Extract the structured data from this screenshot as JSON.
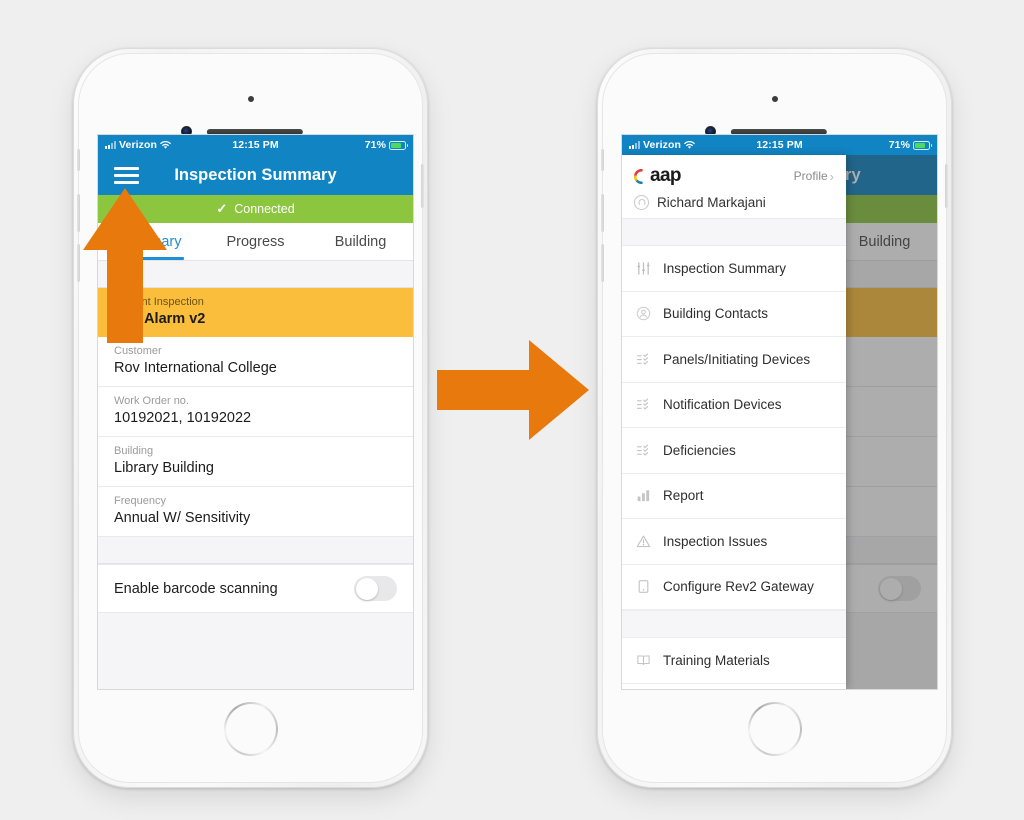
{
  "colors": {
    "page_background": "#efefef",
    "brand_blue": "#1184c4",
    "accent_green": "#8cc63f",
    "highlight_yellow": "#fbbd3c",
    "arrow_orange": "#e8790c",
    "tab_active_blue": "#1e8fd5"
  },
  "status_bar": {
    "carrier": "Verizon",
    "wifi_icon": "wifi-icon",
    "signal_icon": "signal-bars-icon",
    "time": "12:15 PM",
    "battery_percent": "71%",
    "battery_icon": "battery-charging-icon"
  },
  "left_phone": {
    "nav": {
      "menu_icon": "hamburger-menu-icon",
      "title": "Inspection Summary"
    },
    "connection_banner": {
      "check_icon": "✓",
      "label": "Connected"
    },
    "tabs": [
      {
        "label": "Summary",
        "active": true
      },
      {
        "label": "Progress",
        "active": false
      },
      {
        "label": "Building",
        "active": false
      }
    ],
    "fields": [
      {
        "label": "Current Inspection",
        "value": "Fire Alarm v2",
        "highlighted": true
      },
      {
        "label": "Customer",
        "value": "Rov International College",
        "highlighted": false
      },
      {
        "label": "Work Order no.",
        "value": "10192021, 10192022",
        "highlighted": false
      },
      {
        "label": "Building",
        "value": "Library Building",
        "highlighted": false
      },
      {
        "label": "Frequency",
        "value": "Annual W/ Sensitivity",
        "highlighted": false
      }
    ],
    "barcode_toggle": {
      "label": "Enable barcode scanning",
      "state": "off"
    }
  },
  "right_phone": {
    "drawer": {
      "logo_text": "aap",
      "logo_mark": "xaap-logo-icon",
      "profile_link": "Profile",
      "profile_chevron": "›",
      "user_avatar_icon": "user-avatar-icon",
      "user_name": "Richard Markajani",
      "menu_items": [
        {
          "label": "Inspection Summary",
          "icon": "sliders-icon"
        },
        {
          "label": "Building Contacts",
          "icon": "contact-avatar-icon"
        },
        {
          "label": "Panels/Initiating Devices",
          "icon": "checklist-icon"
        },
        {
          "label": "Notification Devices",
          "icon": "checklist-icon"
        },
        {
          "label": "Deficiencies",
          "icon": "checklist-icon"
        },
        {
          "label": "Report",
          "icon": "bar-chart-icon"
        },
        {
          "label": "Inspection Issues",
          "icon": "warning-triangle-icon"
        },
        {
          "label": "Configure Rev2 Gateway",
          "icon": "device-icon"
        }
      ],
      "footer_items": [
        {
          "label": "Training Materials",
          "icon": "book-icon"
        }
      ]
    },
    "background_screen": {
      "nav_title_fragment": "y",
      "visible_tab": "Building"
    }
  },
  "annotations": {
    "arrow_up": "arrow-up-pointing-to-hamburger-menu",
    "arrow_right": "arrow-right-transition"
  }
}
